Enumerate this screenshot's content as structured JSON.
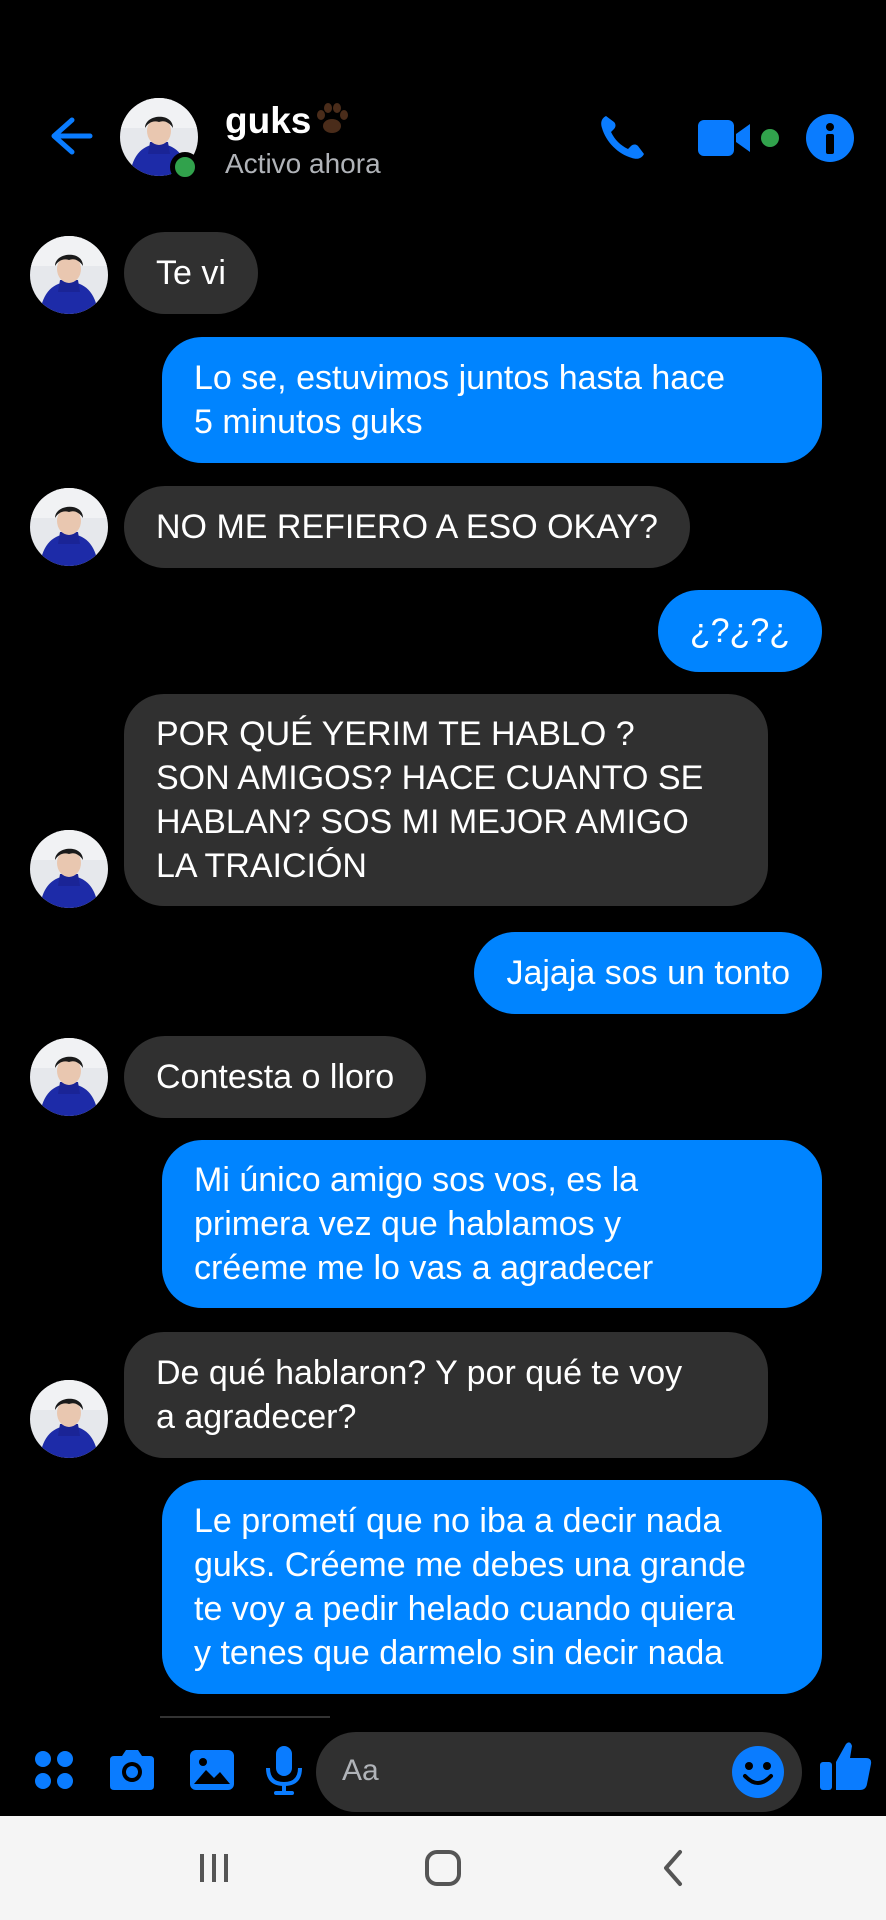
{
  "header": {
    "contact_name": "guks",
    "status": "Activo ahora",
    "icons": [
      "back-arrow-icon",
      "paw-emoji-icon",
      "phone-icon",
      "video-camera-icon",
      "info-icon"
    ]
  },
  "messages": [
    {
      "from": "them",
      "text": "Te vi"
    },
    {
      "from": "me",
      "text": "Lo se, estuvimos juntos hasta hace\n5 minutos guks"
    },
    {
      "from": "them",
      "text": "NO ME REFIERO A ESO OKAY?"
    },
    {
      "from": "me",
      "text": "¿?¿?¿"
    },
    {
      "from": "them",
      "text": "POR QUÉ YERIM TE HABLO ?\nSON AMIGOS? HACE CUANTO SE\nHABLAN? SOS MI MEJOR AMIGO\nLA TRAICIÓN"
    },
    {
      "from": "me",
      "text": "Jajaja sos un tonto"
    },
    {
      "from": "them",
      "text": "Contesta o lloro"
    },
    {
      "from": "me",
      "text": "Mi único amigo sos vos, es la\nprimera vez que hablamos y\ncréeme me lo vas a agradecer"
    },
    {
      "from": "them",
      "text": "De qué hablaron? Y por qué te voy\na agradecer?"
    },
    {
      "from": "me",
      "text": "Le prometí que no iba a decir nada\nguks. Créeme me debes una grande\nte voy a pedir helado cuando quiera\ny tenes que darmelo sin decir nada"
    }
  ],
  "composer": {
    "placeholder": "Aa",
    "icons": [
      "menu-grid-icon",
      "camera-icon",
      "gallery-icon",
      "microphone-icon",
      "emoji-icon",
      "thumbs-up-icon"
    ]
  },
  "navbar": {
    "icons": [
      "recent-apps-icon",
      "home-icon",
      "back-icon"
    ]
  },
  "colors": {
    "accent": "#0084ff",
    "incoming_bubble": "#303030",
    "background": "#000000",
    "online": "#31a24c"
  }
}
